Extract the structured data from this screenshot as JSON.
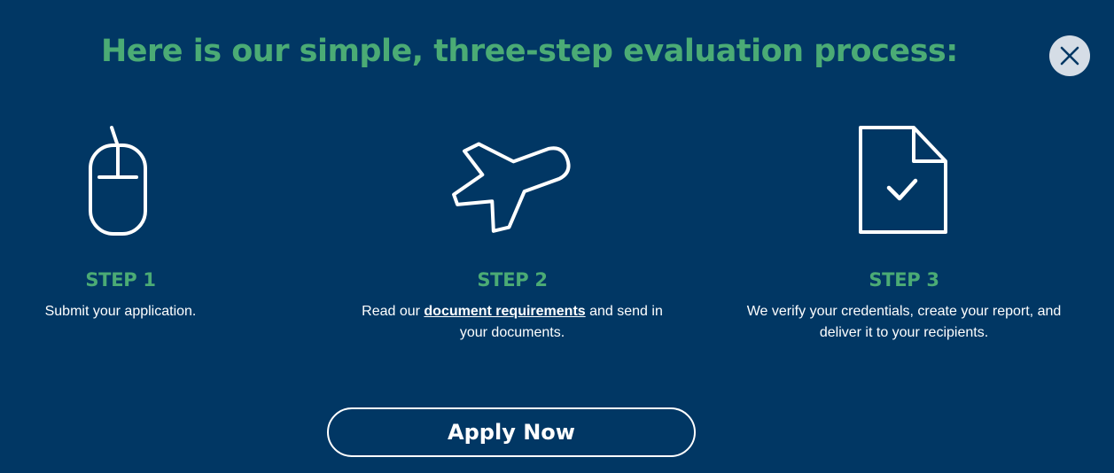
{
  "modal": {
    "headline": "Here is our simple, three-step evaluation process:",
    "close_icon": "close-icon"
  },
  "steps": [
    {
      "icon": "mouse-icon",
      "title": "STEP 1",
      "description": "Submit your application."
    },
    {
      "icon": "airplane-icon",
      "title": "STEP 2",
      "description_before": "Read our ",
      "link_text": "document requirements",
      "description_after": " and send in your documents."
    },
    {
      "icon": "document-check-icon",
      "title": "STEP 3",
      "description": "We verify your credentials, create your report, and deliver it to your recipients."
    }
  ],
  "apply_button": {
    "label": "Apply Now"
  },
  "colors": {
    "background": "#013764",
    "accent_green": "#4bab75",
    "text": "#ffffff",
    "close_button_bg": "#d5dde6"
  }
}
